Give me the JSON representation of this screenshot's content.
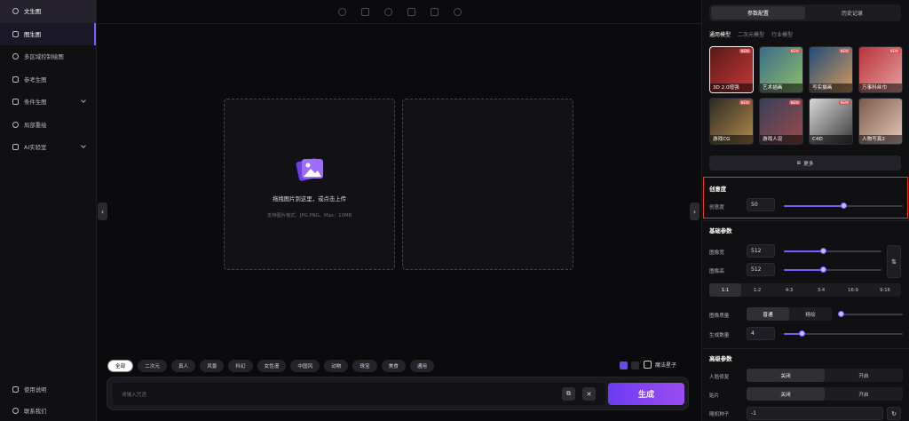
{
  "sidebar": {
    "items": [
      {
        "label": "文生图",
        "icon": "text-image-icon"
      },
      {
        "label": "图生图",
        "icon": "image-image-icon"
      },
      {
        "label": "多区域控制绘图",
        "icon": "region-control-icon"
      },
      {
        "label": "参考生图",
        "icon": "reference-icon"
      },
      {
        "label": "条件生图",
        "icon": "condition-icon"
      },
      {
        "label": "局部重绘",
        "icon": "inpaint-icon"
      },
      {
        "label": "AI实验室",
        "icon": "lab-icon"
      }
    ],
    "bottom": [
      {
        "label": "使用说明",
        "icon": "book-icon"
      },
      {
        "label": "联系我们",
        "icon": "contact-icon"
      }
    ]
  },
  "canvas": {
    "drop_title": "拖拽图片到这里，或点击上传",
    "drop_sub": "支持图片格式：JPG,PNG，Max：10MB"
  },
  "tags": [
    "全部",
    "二次元",
    "真人",
    "风景",
    "科幻",
    "女性漫",
    "中国风",
    "动物",
    "珠宝",
    "美食",
    "通用"
  ],
  "magic_label": "魔法星子",
  "prompt": {
    "placeholder": "请输入咒语",
    "generate": "生成"
  },
  "panel": {
    "tabs": [
      "参数配置",
      "历史记录"
    ],
    "model_tabs": [
      "通用模型",
      "二次元模型",
      "行业模型"
    ],
    "models": [
      {
        "name": "3D 2.0增强",
        "new": "NEW",
        "color1": "#5a1818",
        "color2": "#c43a3a"
      },
      {
        "name": "艺术插画",
        "new": "NEW",
        "color1": "#3b6b8a",
        "color2": "#8fbf6a"
      },
      {
        "name": "写实摄画",
        "new": "NEW",
        "color1": "#1f4c7a",
        "color2": "#d69a5a"
      },
      {
        "name": "万事科丝巾",
        "new": "NEW",
        "color1": "#b8323a",
        "color2": "#e6a0a0"
      },
      {
        "name": "游戏CG",
        "new": "NEW",
        "color1": "#2e2a24",
        "color2": "#b08a4a"
      },
      {
        "name": "游戏人设",
        "new": "NEW",
        "color1": "#3a3f5a",
        "color2": "#9a4a4a"
      },
      {
        "name": "C4D",
        "new": "NEW",
        "color1": "#d8d8d8",
        "color2": "#3a3a3a"
      },
      {
        "name": "人物写真2",
        "new": "",
        "color1": "#7a5a4a",
        "color2": "#e8c8b8"
      }
    ],
    "more": "更多",
    "creativity": {
      "title": "创意度",
      "label": "创意度",
      "value": "50",
      "level": 0.5
    },
    "basic": {
      "title": "基础参数",
      "width_label": "图像宽",
      "width_value": "512",
      "width_level": 0.4,
      "height_label": "图像高",
      "height_value": "512",
      "height_level": 0.4,
      "ratios": [
        "1:1",
        "1:2",
        "4:3",
        "3:4",
        "16:9",
        "9:16"
      ],
      "quality_label": "图像质量",
      "quality_options": [
        "普通",
        "精绘"
      ],
      "quality_level": 0.0,
      "count_label": "生成数量",
      "count_value": "4",
      "count_level": 0.15
    },
    "advanced": {
      "title": "高级参数",
      "face_label": "人脸修复",
      "face_options": [
        "关闭",
        "开启"
      ],
      "tile_label": "贴片",
      "tile_options": [
        "关闭",
        "开启"
      ],
      "seed_label": "随机种子",
      "seed_value": "-1"
    }
  },
  "colors": {
    "accent": "#7c5cff",
    "highlight": "#e5322a",
    "background": "#0b0b0d"
  }
}
